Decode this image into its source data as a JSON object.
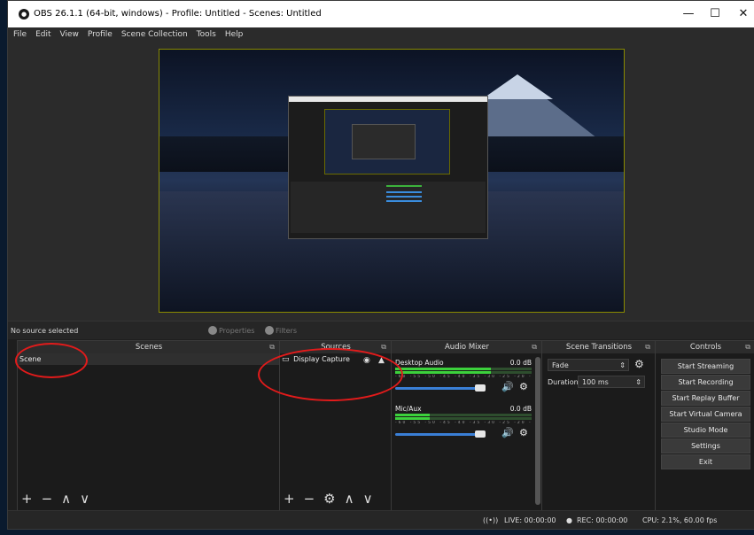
{
  "window": {
    "title": "OBS 26.1.1 (64-bit, windows) - Profile: Untitled - Scenes: Untitled",
    "logo_text": "●",
    "controls": [
      "—",
      "☐",
      "✕"
    ]
  },
  "menu": [
    "File",
    "Edit",
    "View",
    "Profile",
    "Scene Collection",
    "Tools",
    "Help"
  ],
  "source_toolbar": {
    "status": "No source selected",
    "properties": "Properties",
    "filters": "Filters"
  },
  "scenes": {
    "title": "Scenes",
    "items": [
      "Scene"
    ],
    "toolbar": [
      "+",
      "−",
      "∧",
      "∨"
    ]
  },
  "sources": {
    "title": "Sources",
    "items": [
      {
        "label": "Display Capture"
      }
    ],
    "toolbar": [
      "+",
      "−",
      "⚙",
      "∧",
      "∨"
    ]
  },
  "mixer": {
    "title": "Audio Mixer",
    "channels": [
      {
        "name": "Desktop Audio",
        "db": "0.0 dB",
        "level": 0.7,
        "volume": 0.98
      },
      {
        "name": "Mic/Aux",
        "db": "0.0 dB",
        "level": 0.25,
        "volume": 0.98
      }
    ],
    "tick_labels": "-60 -55 -50 -45 -40 -35 -30 -25 -20 -15 -10 -5 0"
  },
  "transitions": {
    "title": "Scene Transitions",
    "selected": "Fade",
    "duration_label": "Duration",
    "duration_value": "100 ms"
  },
  "controls": {
    "title": "Controls",
    "buttons": [
      "Start Streaming",
      "Start Recording",
      "Start Replay Buffer",
      "Start Virtual Camera",
      "Studio Mode",
      "Settings",
      "Exit"
    ]
  },
  "status_bar": {
    "live": "LIVE: 00:00:00",
    "rec": "REC: 00:00:00",
    "cpu": "CPU: 2.1%, 60.00 fps"
  },
  "colors": {
    "annotation_red": "#e11b1b",
    "meter_green": "#3cd13c",
    "slider_blue": "#3a7fd6"
  }
}
